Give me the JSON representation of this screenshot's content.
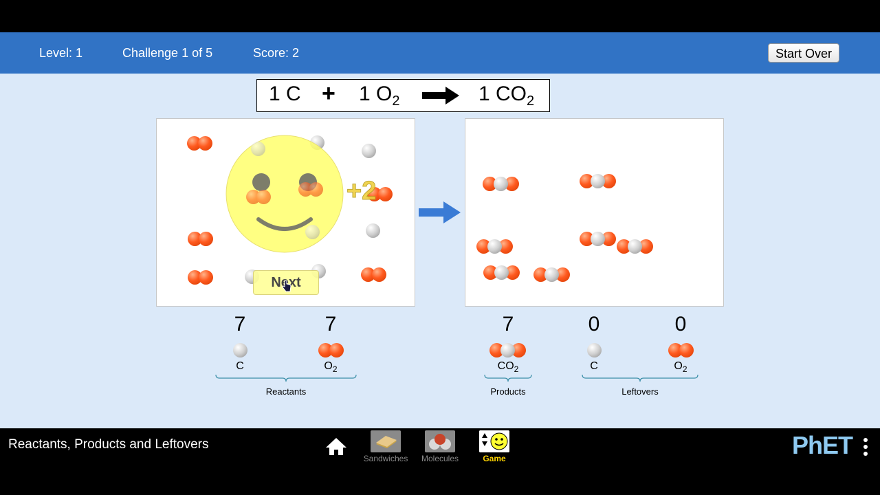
{
  "status": {
    "level": "Level: 1",
    "challenge": "Challenge 1 of 5",
    "score": "Score: 2",
    "start_over": "Start Over"
  },
  "equation": {
    "reactant1": "1 C",
    "plus": "+",
    "reactant2_coef": "1 O",
    "reactant2_sub": "2",
    "product_coef": "1 CO",
    "product_sub": "2"
  },
  "feedback": {
    "points": "+2",
    "next_label": "Next"
  },
  "reactant_counts": {
    "c_count": "7",
    "c_label": "C",
    "o2_count": "7",
    "o2_label_main": "O",
    "o2_label_sub": "2",
    "group": "Reactants"
  },
  "product_counts": {
    "co2_count": "7",
    "co2_label_main": "CO",
    "co2_label_sub": "2",
    "group": "Products"
  },
  "leftover_counts": {
    "c_count": "0",
    "c_label": "C",
    "o2_count": "0",
    "o2_label_main": "O",
    "o2_label_sub": "2",
    "group": "Leftovers"
  },
  "nav": {
    "title": "Reactants, Products and Leftovers",
    "home_icon": "home-icon",
    "screens": [
      "Sandwiches",
      "Molecules",
      "Game"
    ],
    "active_screen": "Game",
    "logo": "PhET"
  },
  "colors": {
    "status_bar": "#3173c5",
    "background": "#dbe9f9",
    "oxygen": "#ff5a1f",
    "carbon": "#cfcfcf",
    "smiley": "#ffff66",
    "active_tab": "#ffd400",
    "logo": "#8ec9f0"
  }
}
